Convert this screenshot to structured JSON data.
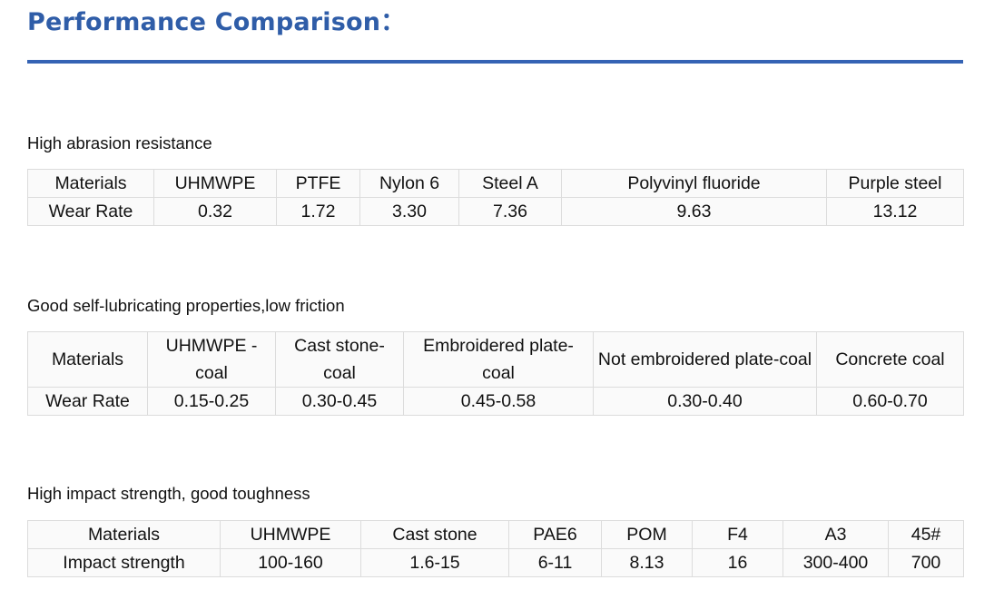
{
  "page": {
    "title": "Performance Comparison："
  },
  "sections": [
    {
      "label": "High abrasion resistance",
      "header": [
        "Materials",
        "UHMWPE",
        "PTFE",
        "Nylon 6",
        "Steel A",
        "Polyvinyl fluoride",
        "Purple steel"
      ],
      "row": [
        "Wear Rate",
        "0.32",
        "1.72",
        "3.30",
        "7.36",
        "9.63",
        "13.12"
      ]
    },
    {
      "label": "Good self-lubricating properties,low friction",
      "header": [
        "Materials",
        "UHMWPE -coal",
        "Cast stone-coal",
        "Embroidered plate-coal",
        "Not embroidered plate-coal",
        "Concrete coal"
      ],
      "row": [
        "Wear Rate",
        "0.15-0.25",
        "0.30-0.45",
        "0.45-0.58",
        "0.30-0.40",
        "0.60-0.70"
      ]
    },
    {
      "label": "High impact strength, good toughness",
      "header": [
        "Materials",
        "UHMWPE",
        "Cast stone",
        "PAE6",
        "POM",
        "F4",
        "A3",
        "45#"
      ],
      "row": [
        "Impact strength",
        "100-160",
        "1.6-15",
        "6-11",
        "8.13",
        "16",
        "300-400",
        "700"
      ]
    }
  ],
  "colors": {
    "title": "#2f5da8",
    "rule": "#3563b4",
    "highlight": "#2845d6",
    "cell_border": "#dcdcdc",
    "cell_background": "#fafafa"
  }
}
